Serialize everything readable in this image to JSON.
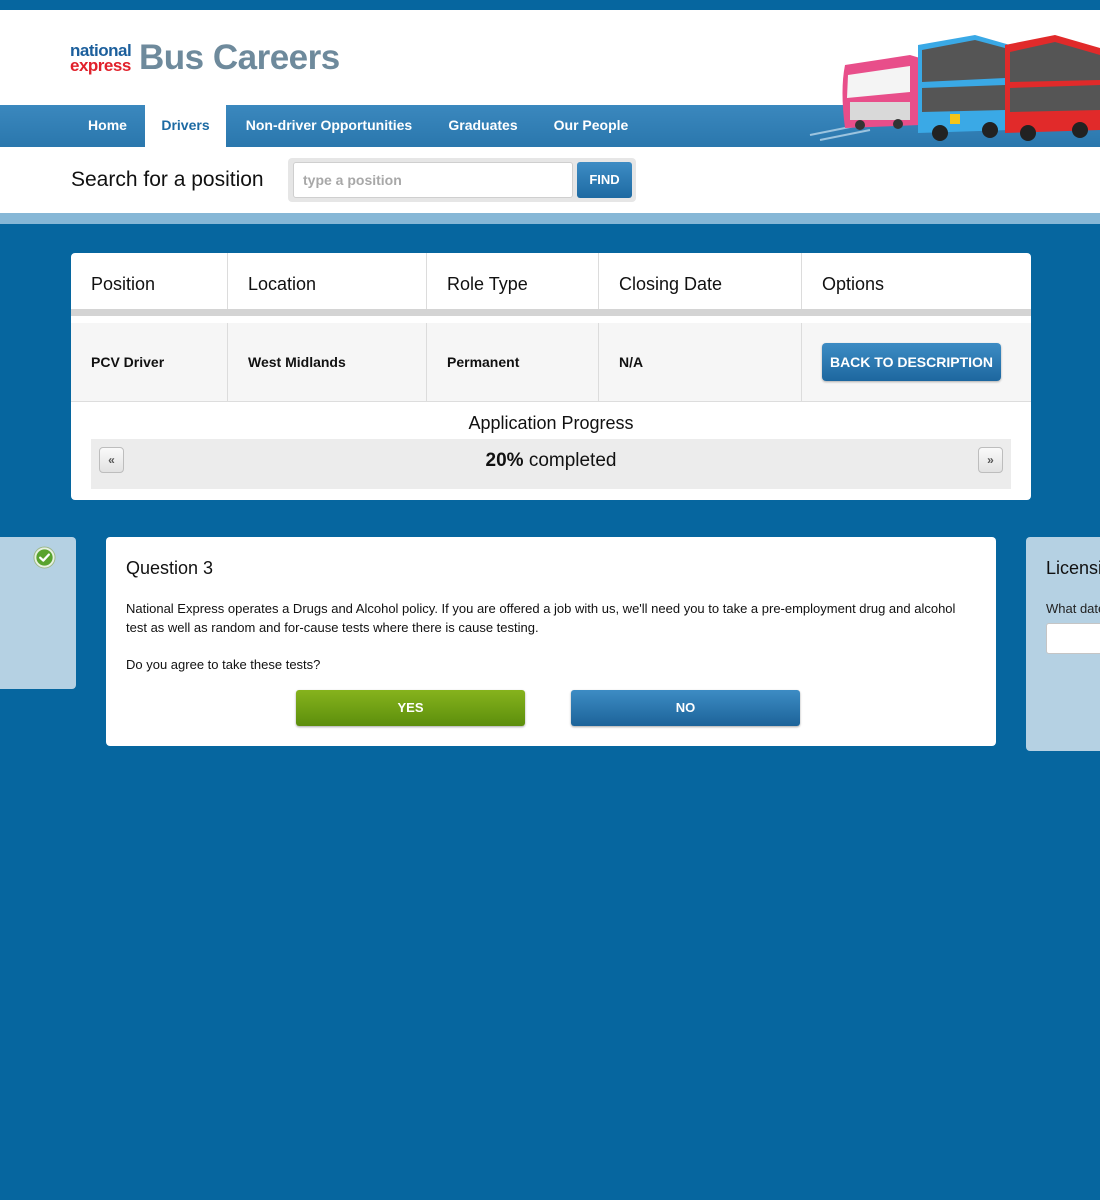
{
  "brand": {
    "logo_line1": "national",
    "logo_line2": "express",
    "site_title": "Bus Careers"
  },
  "nav": {
    "items": [
      {
        "label": "Home",
        "active": false
      },
      {
        "label": "Drivers",
        "active": true
      },
      {
        "label": "Non-driver Opportunities",
        "active": false
      },
      {
        "label": "Graduates",
        "active": false
      },
      {
        "label": "Our People",
        "active": false
      }
    ]
  },
  "search": {
    "label": "Search for a position",
    "placeholder": "type a position",
    "value": "",
    "button_label": "FIND"
  },
  "job_table": {
    "headers": [
      "Position",
      "Location",
      "Role Type",
      "Closing Date",
      "Options"
    ],
    "row": {
      "position": "PCV Driver",
      "location": "West Midlands",
      "role_type": "Permanent",
      "closing_date": "N/A",
      "action_label": "BACK TO DESCRIPTION"
    }
  },
  "progress": {
    "title": "Application Progress",
    "percent": "20%",
    "suffix": "completed",
    "prev_label": "«",
    "next_label": "»"
  },
  "question": {
    "title": "Question 3",
    "body": "National Express operates a Drugs and Alcohol policy. If you are offered a job with us, we'll need you to take a pre-employment drug and alcohol test as well as random and for-cause tests where there is cause testing.",
    "ask": "Do you agree to take these tests?",
    "yes_label": "YES",
    "no_label": "NO"
  },
  "next_card": {
    "title": "Licensi",
    "question": "What date"
  },
  "colors": {
    "page_bg": "#06669f",
    "nav_blue": "#2a77ad",
    "button_blue": "#1e6aa2",
    "yes_green": "#6a9a12",
    "brand_red": "#e1212b",
    "side_card": "#b5d1e3"
  },
  "icons": [
    "check-icon",
    "bus-illustration"
  ]
}
